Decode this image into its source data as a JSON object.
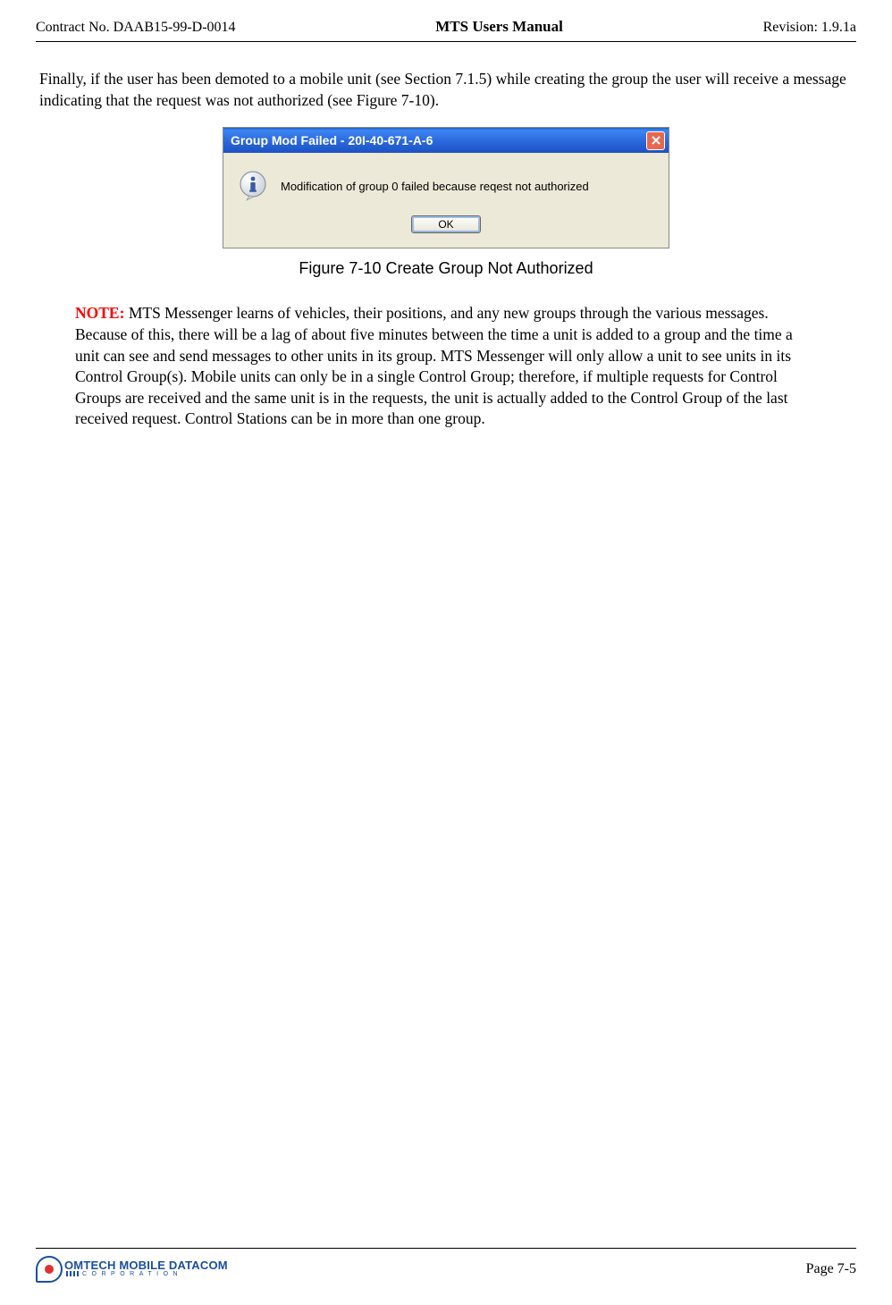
{
  "header": {
    "contract": "Contract No. DAAB15-99-D-0014",
    "title": "MTS Users Manual",
    "revision": "Revision:  1.9.1a"
  },
  "content": {
    "paragraph1": "Finally, if the user has been demoted to a mobile unit (see Section 7.1.5) while creating the group the user will receive a message indicating that the request was not authorized (see Figure 7-10).",
    "figure_caption": "Figure 7-10   Create Group Not Authorized",
    "note_label": "NOTE:",
    "note_body": "  MTS Messenger learns of vehicles, their positions, and any new groups through the various messages.  Because of this, there will be a lag of about five minutes between the time a unit is added to a group and the time a unit can see and send messages to other units in its group.  MTS Messenger will only allow a unit to see units in its Control Group(s).  Mobile units can only be in a single Control Group; therefore, if multiple requests for Control Groups are received and the same unit is in the requests, the unit is actually added to the Control Group of the last received request.  Control Stations can be in more than one group."
  },
  "dialog": {
    "title": "Group Mod Failed - 20I-40-671-A-6",
    "message": "Modification of group 0 failed because reqest not authorized",
    "ok_label": "OK"
  },
  "footer": {
    "logo_brand": "OMTECH",
    "logo_subbrand": "MOBILE DATACOM",
    "logo_corp": "CORPORATION",
    "page": "Page 7-5"
  }
}
